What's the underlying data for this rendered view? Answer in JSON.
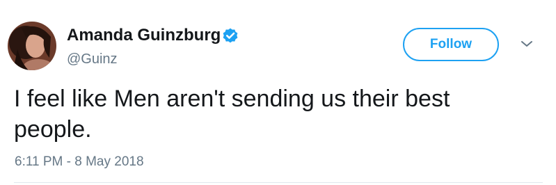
{
  "tweet": {
    "author": {
      "display_name": "Amanda Guinzburg",
      "handle": "@Guinz",
      "verified": true,
      "avatar_icon": "profile-photo"
    },
    "follow_label": "Follow",
    "more_icon": "chevron-down-icon",
    "text": "I feel like Men aren't sending us their best people.",
    "timestamp": "6:11 PM - 8 May 2018"
  },
  "colors": {
    "accent": "#1da1f2",
    "text_primary": "#14171a",
    "text_secondary": "#657786",
    "divider": "#e1e8ed"
  }
}
